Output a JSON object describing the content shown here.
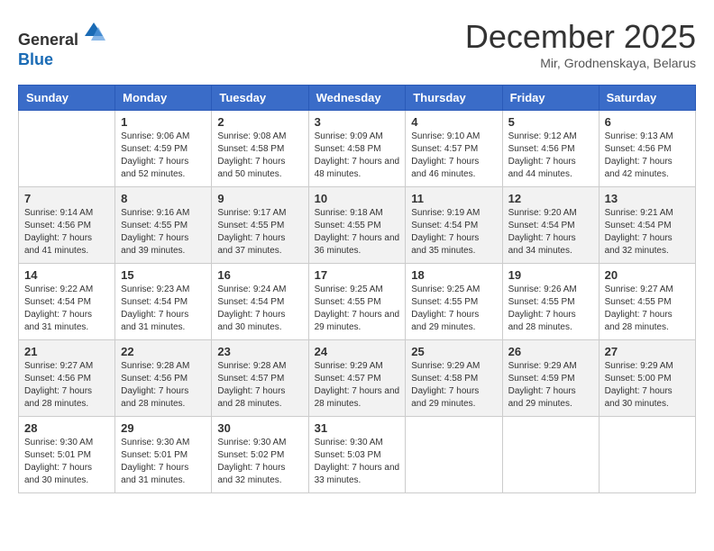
{
  "header": {
    "logo_line1": "General",
    "logo_line2": "Blue",
    "month": "December 2025",
    "location": "Mir, Grodnenskaya, Belarus"
  },
  "weekdays": [
    "Sunday",
    "Monday",
    "Tuesday",
    "Wednesday",
    "Thursday",
    "Friday",
    "Saturday"
  ],
  "weeks": [
    [
      {
        "day": "",
        "sunrise": "",
        "sunset": "",
        "daylight": ""
      },
      {
        "day": "1",
        "sunrise": "Sunrise: 9:06 AM",
        "sunset": "Sunset: 4:59 PM",
        "daylight": "Daylight: 7 hours and 52 minutes."
      },
      {
        "day": "2",
        "sunrise": "Sunrise: 9:08 AM",
        "sunset": "Sunset: 4:58 PM",
        "daylight": "Daylight: 7 hours and 50 minutes."
      },
      {
        "day": "3",
        "sunrise": "Sunrise: 9:09 AM",
        "sunset": "Sunset: 4:58 PM",
        "daylight": "Daylight: 7 hours and 48 minutes."
      },
      {
        "day": "4",
        "sunrise": "Sunrise: 9:10 AM",
        "sunset": "Sunset: 4:57 PM",
        "daylight": "Daylight: 7 hours and 46 minutes."
      },
      {
        "day": "5",
        "sunrise": "Sunrise: 9:12 AM",
        "sunset": "Sunset: 4:56 PM",
        "daylight": "Daylight: 7 hours and 44 minutes."
      },
      {
        "day": "6",
        "sunrise": "Sunrise: 9:13 AM",
        "sunset": "Sunset: 4:56 PM",
        "daylight": "Daylight: 7 hours and 42 minutes."
      }
    ],
    [
      {
        "day": "7",
        "sunrise": "Sunrise: 9:14 AM",
        "sunset": "Sunset: 4:56 PM",
        "daylight": "Daylight: 7 hours and 41 minutes."
      },
      {
        "day": "8",
        "sunrise": "Sunrise: 9:16 AM",
        "sunset": "Sunset: 4:55 PM",
        "daylight": "Daylight: 7 hours and 39 minutes."
      },
      {
        "day": "9",
        "sunrise": "Sunrise: 9:17 AM",
        "sunset": "Sunset: 4:55 PM",
        "daylight": "Daylight: 7 hours and 37 minutes."
      },
      {
        "day": "10",
        "sunrise": "Sunrise: 9:18 AM",
        "sunset": "Sunset: 4:55 PM",
        "daylight": "Daylight: 7 hours and 36 minutes."
      },
      {
        "day": "11",
        "sunrise": "Sunrise: 9:19 AM",
        "sunset": "Sunset: 4:54 PM",
        "daylight": "Daylight: 7 hours and 35 minutes."
      },
      {
        "day": "12",
        "sunrise": "Sunrise: 9:20 AM",
        "sunset": "Sunset: 4:54 PM",
        "daylight": "Daylight: 7 hours and 34 minutes."
      },
      {
        "day": "13",
        "sunrise": "Sunrise: 9:21 AM",
        "sunset": "Sunset: 4:54 PM",
        "daylight": "Daylight: 7 hours and 32 minutes."
      }
    ],
    [
      {
        "day": "14",
        "sunrise": "Sunrise: 9:22 AM",
        "sunset": "Sunset: 4:54 PM",
        "daylight": "Daylight: 7 hours and 31 minutes."
      },
      {
        "day": "15",
        "sunrise": "Sunrise: 9:23 AM",
        "sunset": "Sunset: 4:54 PM",
        "daylight": "Daylight: 7 hours and 31 minutes."
      },
      {
        "day": "16",
        "sunrise": "Sunrise: 9:24 AM",
        "sunset": "Sunset: 4:54 PM",
        "daylight": "Daylight: 7 hours and 30 minutes."
      },
      {
        "day": "17",
        "sunrise": "Sunrise: 9:25 AM",
        "sunset": "Sunset: 4:55 PM",
        "daylight": "Daylight: 7 hours and 29 minutes."
      },
      {
        "day": "18",
        "sunrise": "Sunrise: 9:25 AM",
        "sunset": "Sunset: 4:55 PM",
        "daylight": "Daylight: 7 hours and 29 minutes."
      },
      {
        "day": "19",
        "sunrise": "Sunrise: 9:26 AM",
        "sunset": "Sunset: 4:55 PM",
        "daylight": "Daylight: 7 hours and 28 minutes."
      },
      {
        "day": "20",
        "sunrise": "Sunrise: 9:27 AM",
        "sunset": "Sunset: 4:55 PM",
        "daylight": "Daylight: 7 hours and 28 minutes."
      }
    ],
    [
      {
        "day": "21",
        "sunrise": "Sunrise: 9:27 AM",
        "sunset": "Sunset: 4:56 PM",
        "daylight": "Daylight: 7 hours and 28 minutes."
      },
      {
        "day": "22",
        "sunrise": "Sunrise: 9:28 AM",
        "sunset": "Sunset: 4:56 PM",
        "daylight": "Daylight: 7 hours and 28 minutes."
      },
      {
        "day": "23",
        "sunrise": "Sunrise: 9:28 AM",
        "sunset": "Sunset: 4:57 PM",
        "daylight": "Daylight: 7 hours and 28 minutes."
      },
      {
        "day": "24",
        "sunrise": "Sunrise: 9:29 AM",
        "sunset": "Sunset: 4:57 PM",
        "daylight": "Daylight: 7 hours and 28 minutes."
      },
      {
        "day": "25",
        "sunrise": "Sunrise: 9:29 AM",
        "sunset": "Sunset: 4:58 PM",
        "daylight": "Daylight: 7 hours and 29 minutes."
      },
      {
        "day": "26",
        "sunrise": "Sunrise: 9:29 AM",
        "sunset": "Sunset: 4:59 PM",
        "daylight": "Daylight: 7 hours and 29 minutes."
      },
      {
        "day": "27",
        "sunrise": "Sunrise: 9:29 AM",
        "sunset": "Sunset: 5:00 PM",
        "daylight": "Daylight: 7 hours and 30 minutes."
      }
    ],
    [
      {
        "day": "28",
        "sunrise": "Sunrise: 9:30 AM",
        "sunset": "Sunset: 5:01 PM",
        "daylight": "Daylight: 7 hours and 30 minutes."
      },
      {
        "day": "29",
        "sunrise": "Sunrise: 9:30 AM",
        "sunset": "Sunset: 5:01 PM",
        "daylight": "Daylight: 7 hours and 31 minutes."
      },
      {
        "day": "30",
        "sunrise": "Sunrise: 9:30 AM",
        "sunset": "Sunset: 5:02 PM",
        "daylight": "Daylight: 7 hours and 32 minutes."
      },
      {
        "day": "31",
        "sunrise": "Sunrise: 9:30 AM",
        "sunset": "Sunset: 5:03 PM",
        "daylight": "Daylight: 7 hours and 33 minutes."
      },
      {
        "day": "",
        "sunrise": "",
        "sunset": "",
        "daylight": ""
      },
      {
        "day": "",
        "sunrise": "",
        "sunset": "",
        "daylight": ""
      },
      {
        "day": "",
        "sunrise": "",
        "sunset": "",
        "daylight": ""
      }
    ]
  ]
}
